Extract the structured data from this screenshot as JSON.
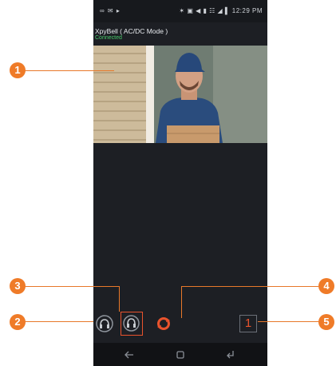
{
  "status_bar": {
    "left_icons": "∞ ✉ ▸",
    "right_text": "✶ ▣ ◀ ▮ ☷ ◢ ▌ 12:29 PM"
  },
  "device": {
    "title": "XpyBell ( AC/DC Mode )",
    "status": "Connected"
  },
  "toolbar": {
    "page_indicator": "1"
  },
  "callouts": [
    "1",
    "2",
    "3",
    "4",
    "5"
  ],
  "colors": {
    "accent": "#ef7b28",
    "connected": "#47c96a",
    "background": "#1d1f24"
  }
}
